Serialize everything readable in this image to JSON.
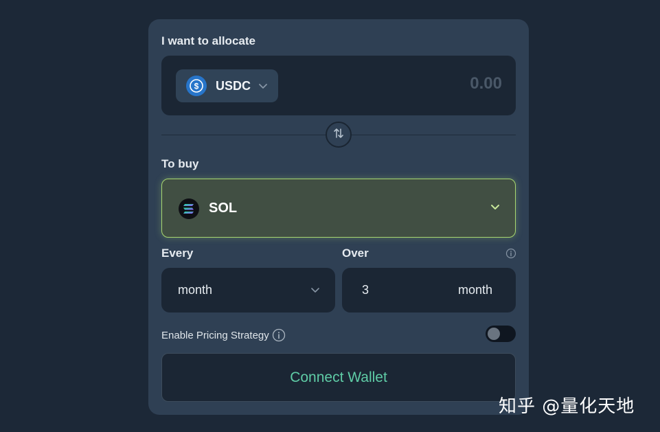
{
  "allocate": {
    "label": "I want to allocate",
    "token": {
      "symbol": "USDC",
      "icon": "usdc-icon",
      "color": "#2775ca"
    },
    "amount_placeholder": "0.00"
  },
  "swap": {
    "icon": "swap-arrows-icon"
  },
  "buy": {
    "label": "To buy",
    "token": {
      "symbol": "SOL",
      "icon": "sol-icon"
    },
    "accent_color": "#a8d870"
  },
  "frequency": {
    "every_label": "Every",
    "every_value": "month",
    "over_label": "Over",
    "over_count": "3",
    "over_unit": "month"
  },
  "pricing_strategy": {
    "label": "Enable Pricing Strategy",
    "enabled": false
  },
  "connect_button": {
    "label": "Connect Wallet",
    "text_color": "#5fcca6"
  },
  "watermark": "知乎 @量化天地"
}
